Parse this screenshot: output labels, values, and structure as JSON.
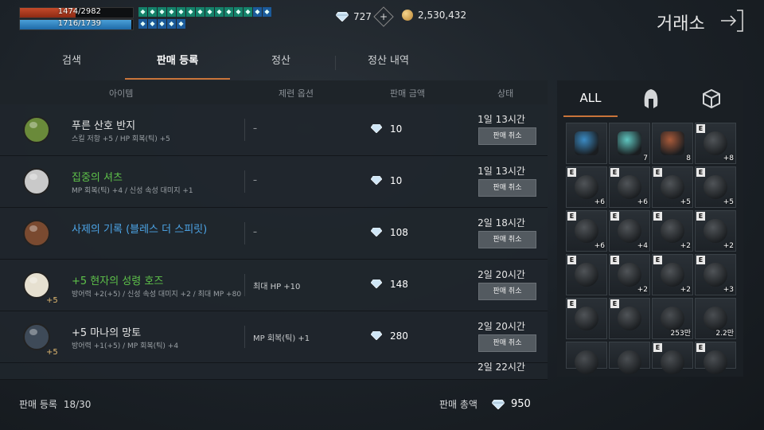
{
  "status": {
    "hp": "1474/2982",
    "hp_fraction": 0.494,
    "mp": "1716/1739",
    "mp_fraction": 0.987
  },
  "buff_icons": [
    "buff",
    "buff",
    "buff",
    "buff",
    "buff",
    "buff",
    "buff",
    "buff",
    "buff",
    "buff",
    "buff",
    "buff",
    "buff",
    "buff",
    "buff",
    "buff",
    "buff",
    "buff",
    "buff"
  ],
  "currency": {
    "diamonds": "727",
    "gold": "2,530,432"
  },
  "header": {
    "title": "거래소"
  },
  "tabs": [
    {
      "label": "검색"
    },
    {
      "label": "판매 등록"
    },
    {
      "label": "정산"
    },
    {
      "label": "정산 내역"
    }
  ],
  "table": {
    "headers": {
      "item": "아이템",
      "option": "제련 옵션",
      "price": "판매 금액",
      "status": "상태"
    },
    "rows": [
      {
        "name": "푸른 산호 반지",
        "desc": "스킬 저항 +5 / HP 회복(틱) +5",
        "option": "–",
        "price": "10",
        "time": "1일 13시간",
        "cancel": "판매 취소",
        "name_color": "#e6e6e6"
      },
      {
        "name": "집중의 셔츠",
        "desc": "MP 회복(틱) +4 / 신성 속성 대미지 +1",
        "option": "–",
        "price": "10",
        "time": "1일 13시간",
        "cancel": "판매 취소",
        "name_color": "#5ec24a"
      },
      {
        "name": "사제의 기록 (블레스 더 스피릿)",
        "desc": "",
        "option": "–",
        "price": "108",
        "time": "2일 18시간",
        "cancel": "판매 취소",
        "name_color": "#4ca4e6"
      },
      {
        "name": "+5 현자의 성령 호즈",
        "desc": "방어력 +2(+5) / 신성 속성 대미지 +2 / 최대 MP +80",
        "option": "최대 HP +10",
        "price": "148",
        "time": "2일 20시간",
        "cancel": "판매 취소",
        "name_color": "#5ec24a",
        "badge": "+5"
      },
      {
        "name": "+5 마나의 망토",
        "desc": "방어력 +1(+5) / MP 회복(틱) +4",
        "option": "MP 회복(틱) +1",
        "price": "280",
        "time": "2일 20시간",
        "cancel": "판매 취소",
        "name_color": "#e6e6e6",
        "badge": "+5"
      },
      {
        "name": "",
        "desc": "",
        "option": "",
        "price": "",
        "time": "2일 22시간",
        "cancel": "",
        "name_color": "#e6e6e6"
      }
    ]
  },
  "footer": {
    "reg_label": "판매 등록",
    "reg_value": "18/30",
    "total_label": "판매 총액",
    "total_value": "950"
  },
  "inventory": {
    "tabs": [
      {
        "label": "ALL"
      },
      {
        "icon": "helmet-icon"
      },
      {
        "icon": "box-icon"
      }
    ],
    "items": [
      {
        "e": false,
        "count": "",
        "color": "#3b8bc4"
      },
      {
        "e": false,
        "count": "7",
        "color": "#5fc6c0"
      },
      {
        "e": false,
        "count": "8",
        "color": "#a85a3a"
      },
      {
        "e": true,
        "count": "+8",
        "color": "#505458"
      },
      {
        "e": true,
        "count": "+6",
        "color": "#505458"
      },
      {
        "e": true,
        "count": "+6",
        "color": "#505458"
      },
      {
        "e": true,
        "count": "+5",
        "color": "#505458"
      },
      {
        "e": true,
        "count": "+5",
        "color": "#505458"
      },
      {
        "e": true,
        "count": "+6",
        "color": "#505458"
      },
      {
        "e": true,
        "count": "+4",
        "color": "#505458"
      },
      {
        "e": true,
        "count": "+2",
        "color": "#505458"
      },
      {
        "e": true,
        "count": "+2",
        "color": "#505458"
      },
      {
        "e": true,
        "count": "",
        "color": "#505458"
      },
      {
        "e": true,
        "count": "+2",
        "color": "#505458"
      },
      {
        "e": true,
        "count": "+2",
        "color": "#505458"
      },
      {
        "e": true,
        "count": "+3",
        "color": "#505458"
      },
      {
        "e": true,
        "count": "",
        "color": "#505458"
      },
      {
        "e": true,
        "count": "",
        "color": "#505458"
      },
      {
        "e": false,
        "count": "253만",
        "color": "#4a4e52"
      },
      {
        "e": false,
        "count": "2.2만",
        "color": "#4a4e52"
      },
      {
        "e": false,
        "count": "",
        "color": "#4a4e52"
      },
      {
        "e": false,
        "count": "",
        "color": "#4a4e52"
      },
      {
        "e": true,
        "count": "",
        "color": "#4a4e52"
      },
      {
        "e": true,
        "count": "",
        "color": "#4a4e52"
      }
    ]
  }
}
